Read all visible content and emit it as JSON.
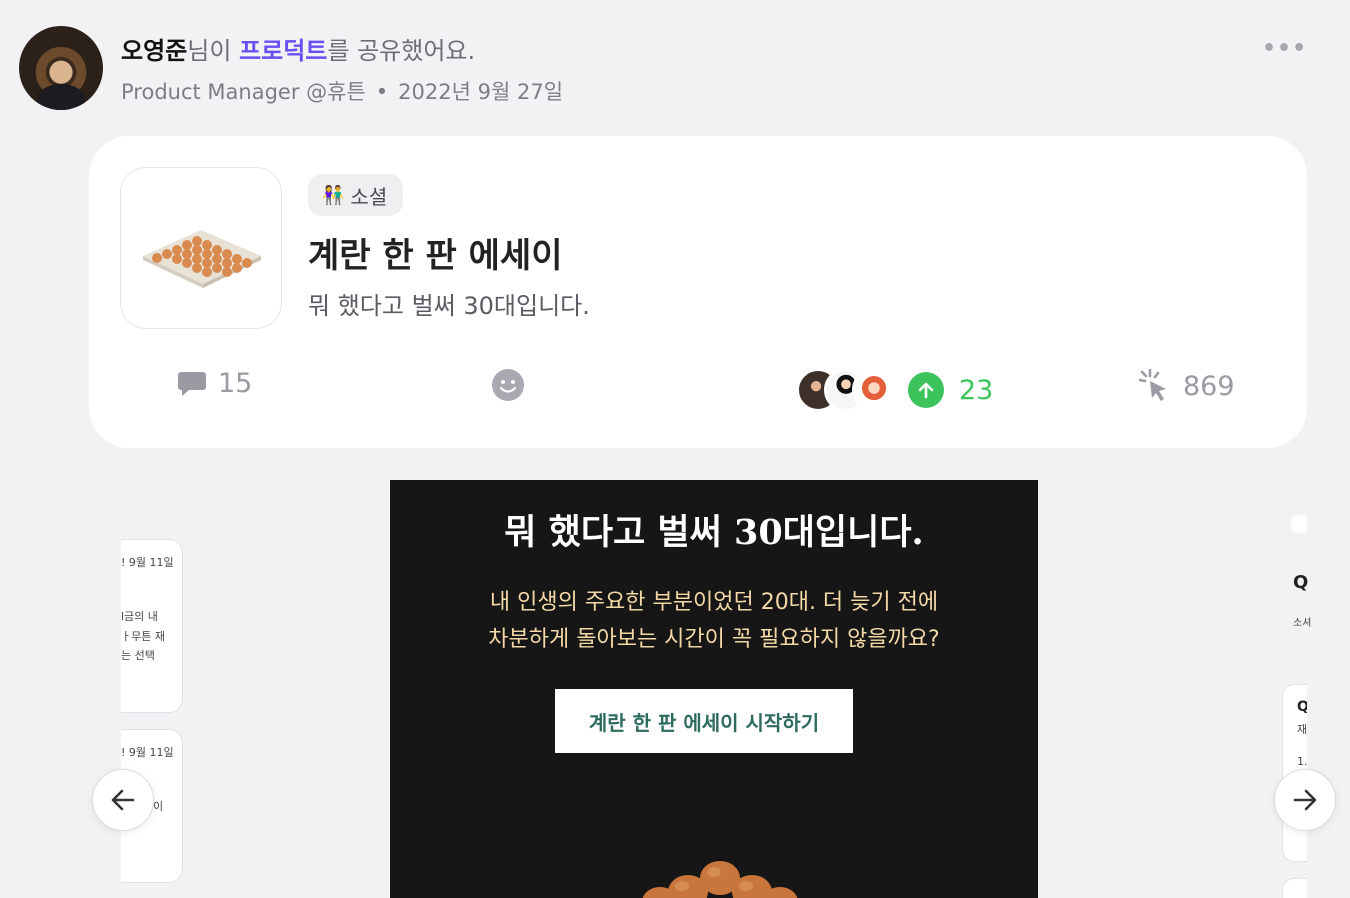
{
  "post_header": {
    "author_name": "오영준",
    "honorific_text": "님이",
    "product_link": "프로덕트",
    "action_text": "를 공유했어요.",
    "author_role": "Product Manager @휴튼",
    "separator": "•",
    "date": "2022년 9월 27일",
    "more_label": "•••"
  },
  "product_card": {
    "category_emoji": "👫",
    "category_label": "소셜",
    "title": "계란 한 판 에세이",
    "tagline": "뭐 했다고 벌써 30대입니다."
  },
  "stats": {
    "comment_count": "15",
    "upvote_count": "23",
    "view_count": "869"
  },
  "slide": {
    "heading": "뭐 했다고 벌써 30대입니다.",
    "body_line1": "내 인생의 주요한 부분이었던 20대. 더 늦기 전에",
    "body_line2": "차분하게 돌아보는 시간이 꼭 필요하지 않을까요?",
    "cta_label": "계란 한 판 에세이 시작하기"
  },
  "side_slides": {
    "left1": {
      "date": "! 9월 11일",
      "line1": "l금의 내",
      "line2": "ㅏ무튼 재",
      "line3": "는 선택"
    },
    "left2": {
      "date": "! 9월 11일",
      "line1": "이"
    },
    "right1": {
      "head": "Q",
      "sub": "소셔"
    },
    "right2": {
      "head": "Q",
      "sub": "재",
      "num": "1."
    }
  },
  "colors": {
    "accent_purple": "#6b4ef0",
    "upvote_green": "#3cc35c",
    "slide_bg": "#161616",
    "slide_text_gold": "#f4d9a6",
    "cta_text_green": "#2d6b5e"
  },
  "icons": [
    "more-icon",
    "people-icon",
    "comment-icon",
    "emoji-icon",
    "upvote-arrow-icon",
    "click-views-icon",
    "arrow-left-icon",
    "arrow-right-icon"
  ]
}
